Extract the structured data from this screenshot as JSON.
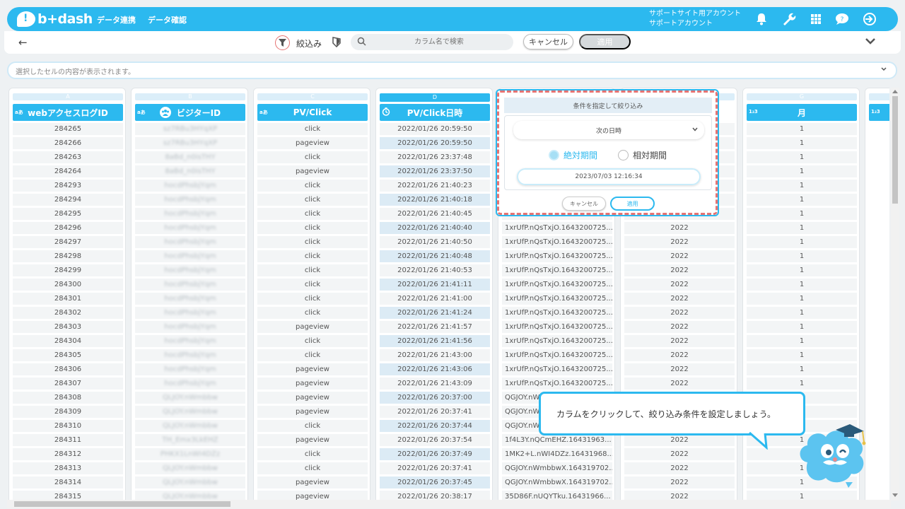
{
  "app": {
    "logo_text": "b+dash"
  },
  "nav": {
    "items": [
      "データ連携",
      "データ確認"
    ]
  },
  "account": {
    "line1": "サポートサイト用アカウント",
    "line2": "サポートアカウント"
  },
  "toolbar": {
    "back_icon": "back-arrow-icon",
    "filter_label": "絞込み",
    "search_placeholder": "カラム名で検索",
    "cancel_label": "キャンセル",
    "apply_label": "適用"
  },
  "cellbar": {
    "placeholder": "選択したセルの内容が表示されます。"
  },
  "columns": [
    {
      "letter": "A",
      "type": "aあ",
      "header": "webアクセスログID"
    },
    {
      "letter": "B",
      "type": "aあ",
      "header": "ビジターID"
    },
    {
      "letter": "C",
      "type": "aあ",
      "header": "PV/Click"
    },
    {
      "letter": "D",
      "type": "clock",
      "header": "PV/Click日時"
    },
    {
      "letter": "E",
      "type": "",
      "header": ""
    },
    {
      "letter": "F",
      "type": "",
      "header": ""
    },
    {
      "letter": "G",
      "type": "1₂3",
      "header": "月"
    },
    {
      "letter": "H",
      "type": "1₂3",
      "header": ""
    }
  ],
  "rows": {
    "ids": [
      "284265",
      "284266",
      "284263",
      "284264",
      "284293",
      "284294",
      "284295",
      "284296",
      "284297",
      "284298",
      "284299",
      "284300",
      "284301",
      "284302",
      "284303",
      "284304",
      "284305",
      "284306",
      "284307",
      "284308",
      "284309",
      "284310",
      "284311",
      "284312",
      "284313",
      "284314",
      "284315"
    ],
    "visitor": [
      "sz7RBu3HYqXP",
      "sz7RBu3HYqXP",
      "8aBd_n0isTHY",
      "8aBd_n0isTHY",
      "hocdPhsbjYqm",
      "hocdPhsbjYqm",
      "hocdPhsbjYqm",
      "hocdPhsbjYqm",
      "hocdPhsbjYqm",
      "hocdPhsbjYqm",
      "hocdPhsbjYqm",
      "hocdPhsbjYqm",
      "hocdPhsbjYqm",
      "hocdPhsbjYqm",
      "hocdPhsbjYqm",
      "hocdPhsbjYqm",
      "hocdPhsbjYqm",
      "hocdPhsbjYqm",
      "hocdPhsbjYqm",
      "QLJOY.nWmbbw",
      "QLJOY.nWmbbw",
      "QLJOY.nWmbbw",
      "TH_Emx3LkEHZ",
      "PHKX1LnWI4DZz",
      "QLJOY.nWmbbw",
      "QLJOY.nWmbbw",
      "QLJOY.nWmbbw"
    ],
    "pvclick": [
      "click",
      "pageview",
      "click",
      "pageview",
      "click",
      "click",
      "click",
      "click",
      "click",
      "click",
      "click",
      "click",
      "click",
      "click",
      "pageview",
      "click",
      "click",
      "pageview",
      "pageview",
      "pageview",
      "pageview",
      "click",
      "pageview",
      "click",
      "click",
      "pageview",
      "pageview"
    ],
    "datetime": [
      "2022/01/26 20:59:50",
      "2022/01/26 20:59:50",
      "2022/01/26 23:37:48",
      "2022/01/26 23:37:50",
      "2022/01/26 21:40:23",
      "2022/01/26 21:40:18",
      "2022/01/26 21:40:45",
      "2022/01/26 21:40:40",
      "2022/01/26 21:40:50",
      "2022/01/26 21:40:48",
      "2022/01/26 21:40:53",
      "2022/01/26 21:41:11",
      "2022/01/26 21:41:00",
      "2022/01/26 21:41:24",
      "2022/01/26 21:41:57",
      "2022/01/26 21:41:56",
      "2022/01/26 21:43:00",
      "2022/01/26 21:43:06",
      "2022/01/26 21:43:09",
      "2022/01/26 20:37:00",
      "2022/01/26 20:37:41",
      "2022/01/26 20:37:44",
      "2022/01/26 20:37:54",
      "2022/01/26 20:37:49",
      "2022/01/26 20:37:41",
      "2022/01/26 20:37:45",
      "2022/01/26 20:38:17"
    ],
    "session": [
      "",
      "",
      "",
      "",
      "",
      "",
      "",
      "1xrUfP.nQsTxjO.1643200725...",
      "1xrUfP.nQsTxjO.1643200725...",
      "1xrUfP.nQsTxjO.1643200725...",
      "1xrUfP.nQsTxjO.1643200725...",
      "1xrUfP.nQsTxjO.1643200725...",
      "1xrUfP.nQsTxjO.1643200725...",
      "1xrUfP.nQsTxjO.1643200725...",
      "1xrUfP.nQsTxjO.1643200725...",
      "1xrUfP.nQsTxjO.1643200725...",
      "1xrUfP.nQsTxjO.1643200725...",
      "1xrUfP.nQsTxjO.1643200725...",
      "1xrUfP.nQsTxjO.1643200725...",
      "QGJOY.nW",
      "QGJOY.nW",
      "QGJOY.nW",
      "1f4L3Y.nQCmEHZ.16431963...",
      "1MK2+L.nWI4DZz.16431968...",
      "QGJOY.nWmbbwX.164319702...",
      "QGJOY.nWmbbwX.164319702...",
      "35D86F.nUQYTku.16431966..."
    ],
    "year": [
      "",
      "",
      "",
      "",
      "",
      "",
      "",
      "2022",
      "2022",
      "2022",
      "2022",
      "2022",
      "2022",
      "2022",
      "2022",
      "2022",
      "2022",
      "2022",
      "2022",
      "",
      "",
      "",
      "2022",
      "2022",
      "2022",
      "2022",
      "2022"
    ],
    "month": [
      "1",
      "1",
      "1",
      "1",
      "1",
      "1",
      "1",
      "1",
      "1",
      "1",
      "1",
      "1",
      "1",
      "1",
      "1",
      "1",
      "1",
      "1",
      "1",
      "1",
      "1",
      "1",
      "1",
      "1",
      "1",
      "1",
      "1"
    ]
  },
  "popover": {
    "title": "条件を指定して絞り込み",
    "select_value": "次の日時",
    "radio_absolute": "絶対期間",
    "radio_relative": "相対期間",
    "date_value": "2023/07/03 12:16:34",
    "cancel_label": "キャンセル",
    "apply_label": "適用"
  },
  "tooltip": {
    "text": "カラムをクリックして、絞り込み条件を設定しましょう。"
  },
  "colors": {
    "accent": "#2cb9ef",
    "highlight": "#e57373"
  }
}
